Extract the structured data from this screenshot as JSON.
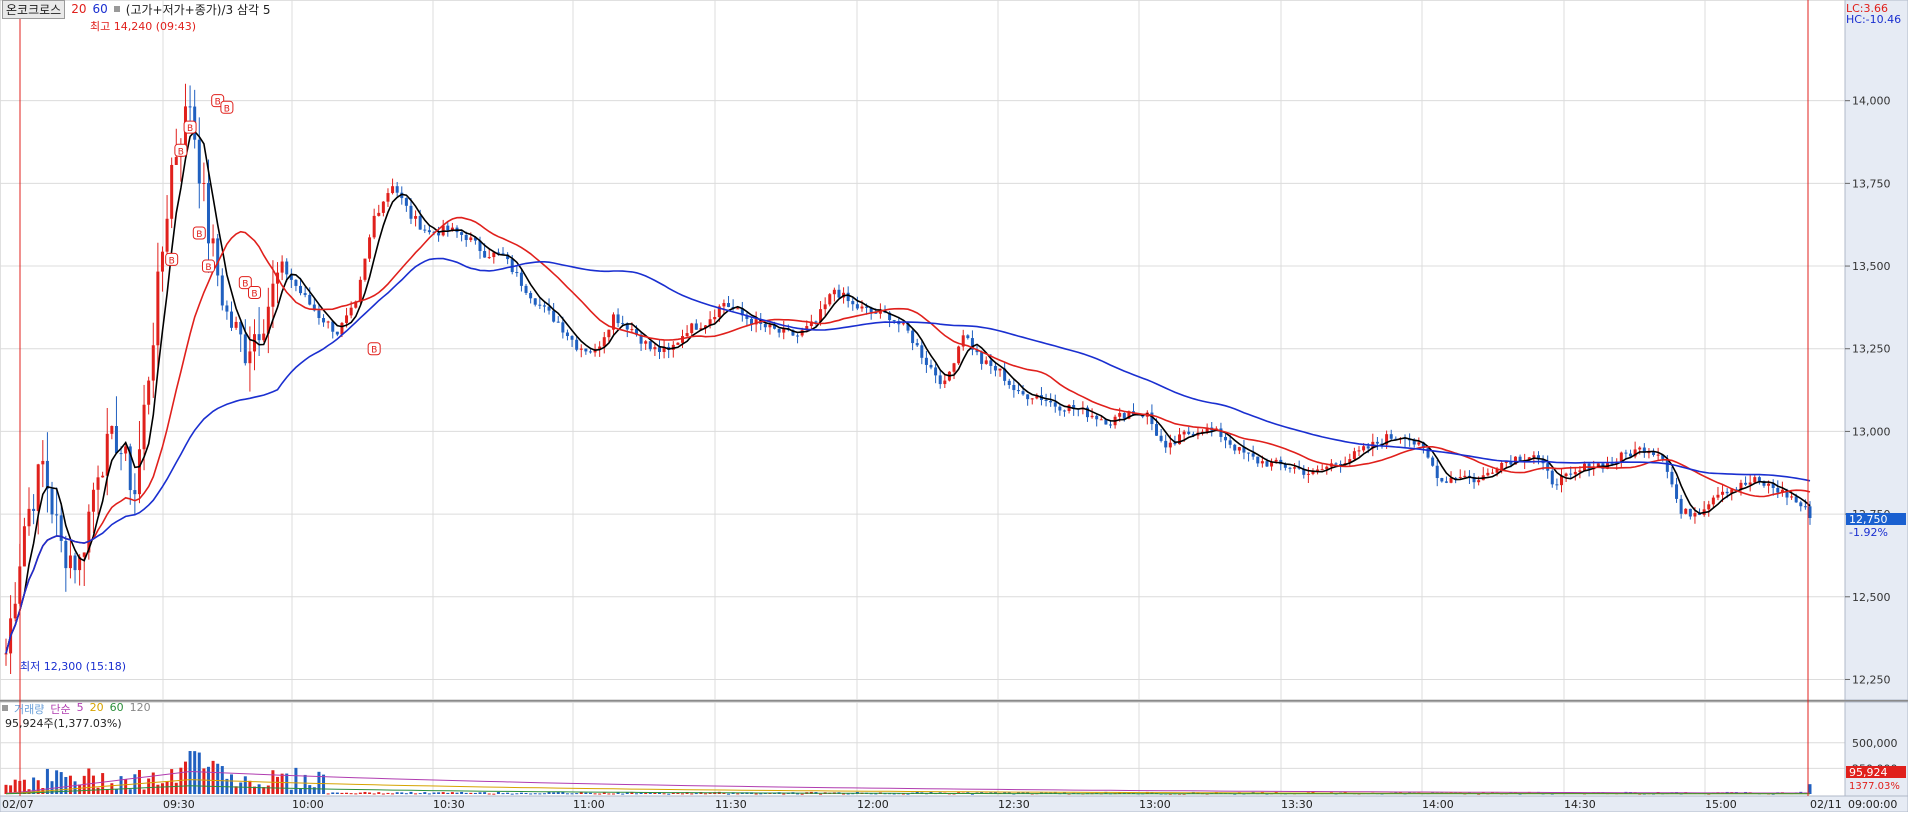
{
  "header": {
    "stock_name": "온코크로스",
    "ma_periods": [
      "20",
      "60"
    ],
    "ma_colors": [
      "#e0201c",
      "#1a2fd0"
    ],
    "formula_label": "(고가+저가+종가)/3 삼각 5"
  },
  "top_right": {
    "lc_label": "LC:3.66",
    "hc_label": "HC:-10.46"
  },
  "price_panel": {
    "y_min": 12200,
    "y_max": 14250,
    "y_ticks": [
      12250,
      12500,
      12750,
      13000,
      13250,
      13500,
      13750,
      14000
    ],
    "y_tick_labels": [
      "12,250",
      "12,500",
      "12,750",
      "13,000",
      "13,250",
      "13,500",
      "13,750",
      "14,000"
    ],
    "high_annotation": "최고 14,240 (09:43)",
    "low_annotation": "최저 12,300 (15:18)",
    "last_price_label": "12,750",
    "last_change_label": "-1.92%",
    "signal_marker": "B"
  },
  "volume_panel": {
    "legend": [
      {
        "label": "거래량",
        "color": "#6a9fd8"
      },
      {
        "label": "단순",
        "color": "#b03cb0"
      },
      {
        "label": "5",
        "color": "#b03cb0"
      },
      {
        "label": "20",
        "color": "#d6a300"
      },
      {
        "label": "60",
        "color": "#2b8f3a"
      },
      {
        "label": "120",
        "color": "#888888"
      }
    ],
    "current_volume_label": "95,924주(1,377.03%)",
    "y_max": 800000,
    "y_ticks": [
      250000,
      500000
    ],
    "y_tick_labels": [
      "250,000",
      "500,000"
    ],
    "last_volume_label": "95,924",
    "last_volume_pct_label": "1377.03%"
  },
  "x_axis": {
    "labels": [
      "02/07",
      "09:30",
      "10:00",
      "10:30",
      "11:00",
      "11:30",
      "12:00",
      "12:30",
      "13:00",
      "13:30",
      "14:00",
      "14:30",
      "15:00",
      "02/11",
      "09:00:00"
    ]
  },
  "chart_data": {
    "type": "candlestick",
    "x_labels": [
      "02/07",
      "09:30",
      "10:00",
      "10:30",
      "11:00",
      "11:30",
      "12:00",
      "12:30",
      "13:00",
      "13:30",
      "14:00",
      "14:30",
      "15:00",
      "02/11"
    ],
    "price_anchors": {
      "time_index": [
        0,
        4,
        8,
        12,
        16,
        20,
        24,
        28,
        32,
        36,
        40,
        44,
        48,
        52,
        56,
        60,
        64,
        68,
        72,
        76,
        80,
        84,
        88,
        92,
        96,
        100,
        104,
        108,
        112,
        116,
        120,
        124,
        128,
        132,
        136,
        140,
        144,
        148,
        152,
        156,
        160,
        164,
        168,
        172,
        176,
        180,
        184,
        188,
        192,
        196,
        200,
        204,
        208,
        212,
        216,
        220,
        224,
        228,
        232,
        236,
        240,
        244,
        248,
        252,
        256,
        260,
        264,
        268,
        272,
        276,
        280,
        284,
        288,
        292,
        296,
        300,
        304,
        308,
        312,
        316,
        320,
        324,
        328,
        332,
        336,
        340,
        344,
        348,
        352,
        356,
        360,
        364,
        368,
        372,
        376,
        380,
        384,
        388,
        392
      ],
      "close": [
        12330,
        12720,
        12900,
        12650,
        12600,
        12900,
        12980,
        12820,
        13300,
        13800,
        14000,
        13600,
        13350,
        13250,
        13350,
        13500,
        13420,
        13350,
        13300,
        13380,
        13650,
        13750,
        13650,
        13600,
        13610,
        13590,
        13540,
        13530,
        13450,
        13380,
        13330,
        13260,
        13240,
        13350,
        13310,
        13250,
        13240,
        13310,
        13330,
        13390,
        13350,
        13320,
        13300,
        13290,
        13330,
        13430,
        13380,
        13360,
        13350,
        13300,
        13210,
        13140,
        13300,
        13210,
        13180,
        13110,
        13110,
        13080,
        13070,
        13050,
        13030,
        13060,
        13050,
        12940,
        12990,
        13010,
        12990,
        12940,
        12910,
        12900,
        12890,
        12870,
        12900,
        12920,
        12950,
        12980,
        12990,
        12940,
        12850,
        12870,
        12850,
        12900,
        12920,
        12930,
        12850,
        12860,
        12900,
        12900,
        12930,
        12950,
        12930,
        12750,
        12760,
        12820,
        12830,
        12850,
        12830,
        12800,
        12750
      ]
    },
    "ma20_color": "#e0201c",
    "ma60_color": "#1a2fd0",
    "ma5_color": "#000000",
    "up_color": "#e0201c",
    "down_color": "#2060c0",
    "y_range": [
      12200,
      14250
    ],
    "volume_y_max": 800000,
    "grid": true,
    "legend_position": "top-left"
  }
}
